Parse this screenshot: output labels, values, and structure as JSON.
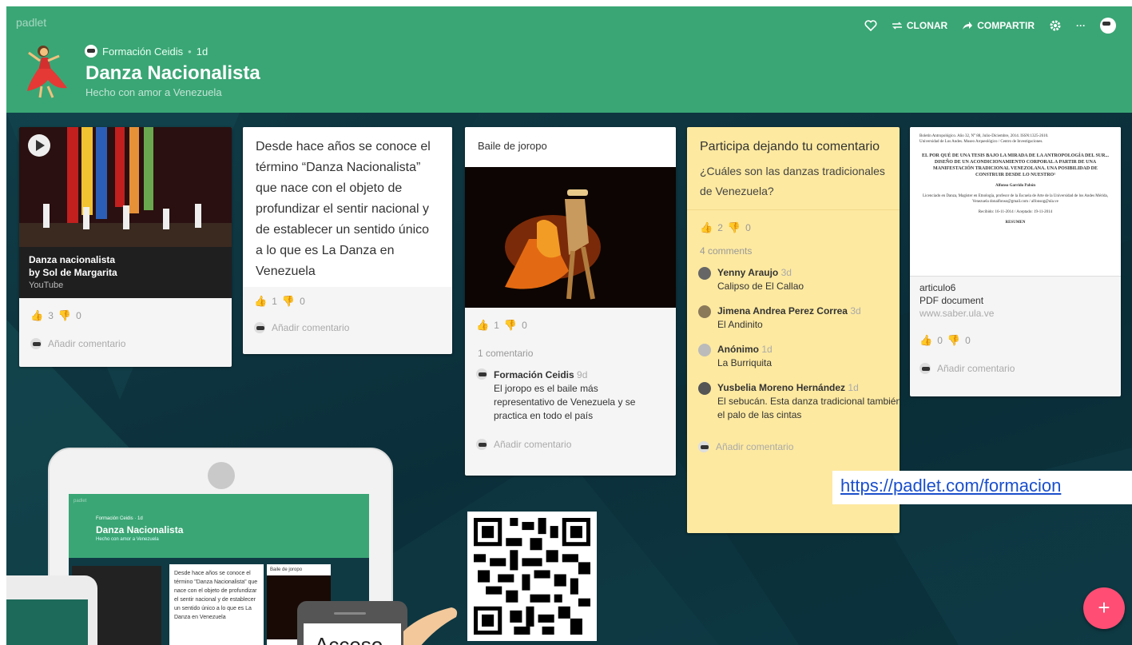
{
  "app": {
    "brand": "padlet"
  },
  "header": {
    "author": "Formación Ceidis",
    "age": "1d",
    "title": "Danza Nacionalista",
    "subtitle": "Hecho con amor a Venezuela"
  },
  "actions": {
    "clone": "CLONAR",
    "share": "COMPARTIR",
    "more": "···"
  },
  "cards": {
    "c1": {
      "video_title": "Danza nacionalista",
      "video_author": "by Sol de Margarita",
      "video_source": "YouTube",
      "likes": "3",
      "dislikes": "0",
      "add_comment": "Añadir comentario"
    },
    "c2": {
      "text": "Desde hace años se conoce el término “Danza Nacionalista” que nace con el objeto de profundizar el sentir nacional y de establecer un sentido único a lo que es La Danza en Venezuela",
      "likes": "1",
      "dislikes": "0",
      "add_comment": "Añadir comentario"
    },
    "c3": {
      "title": "Baile de joropo",
      "likes": "1",
      "dislikes": "0",
      "comment_count": "1 comentario",
      "comment_author": "Formación Ceidis",
      "comment_date": "9d",
      "comment_text": "El joropo es el baile más representativo de Venezuela y se practica en todo el país",
      "add_comment": "Añadir comentario"
    },
    "c4": {
      "title": "Participa dejando tu comentario",
      "question": "¿Cuáles son las danzas tradicionales de Venezuela?",
      "likes": "2",
      "dislikes": "0",
      "comment_count": "4 comments",
      "comments": [
        {
          "author": "Yenny Araujo",
          "date": "3d",
          "text": "Calipso de El Callao"
        },
        {
          "author": "Jimena Andrea Perez Correa",
          "date": "3d",
          "text": "El Andinito"
        },
        {
          "author": "Anónimo",
          "date": "1d",
          "text": "La Burriquita"
        },
        {
          "author": "Yusbelia Moreno Hernández",
          "date": "1d",
          "text": "El sebucán. Esta danza tradicional también se conoce como l",
          "text2": "el palo de las cintas"
        }
      ],
      "add_comment": "Añadir comentario"
    },
    "c5": {
      "doc_line1": "Boletín Antropológico. Año 32, N° 88, Julio-Diciembre, 2014. ISSN:1325-2610.",
      "doc_line2": "Universidad de Los Andes. Museo Arqueológico / Centro de Investigaciones.",
      "doc_heading": "EL POR QUÉ DE UNA TESIS BAJO LA MIRADA DE LA ANTROPOLOGÍA DEL SUR... DISEÑO DE UN ACONDICIONAMIENTO CORPORAL A PARTIR DE UNA MANIFESTACIÓN TRADICIONAL VENEZOLANA. UNA POSIBILIDAD DE CONSTRUIR DESDE LO NUESTRO¹",
      "doc_author": "Alfonso Garrido Pabón",
      "doc_bio": "Licenciado en Danza, Magíster en Etnología, profesor de la Escuela de Arte de la Universidad de los Andes Mérida, Venezuela donalfonso@gmail.com / alfonsog@ula.ve",
      "doc_dates": "Recibido: 16-11-2014 / Aceptado: 19-11-2014",
      "doc_summary": "RESUMEN",
      "file_name": "articulo6",
      "file_type": "PDF document",
      "file_url": "www.saber.ula.ve",
      "likes": "0",
      "dislikes": "0",
      "add_comment": "Añadir comentario"
    }
  },
  "overlay": {
    "url": "https://padlet.com/formacion",
    "phone_text": "Acceso",
    "fab": "+"
  },
  "tablet": {
    "author": "Formación Ceidis · 1d",
    "title": "Danza Nacionalista",
    "subtitle": "Hecho con amor a Venezuela",
    "card_text": "Desde hace años se conoce el término \"Danza Nacionalista\" que nace con el objeto de profundizar el sentir nacional y de establecer un sentido único a lo que es La Danza en Venezuela",
    "card2_title": "Baile de joropo",
    "brand": "padlet"
  },
  "colors": {
    "header": "#3aa675",
    "like": "#ff5733",
    "fab": "#ff4d73"
  }
}
